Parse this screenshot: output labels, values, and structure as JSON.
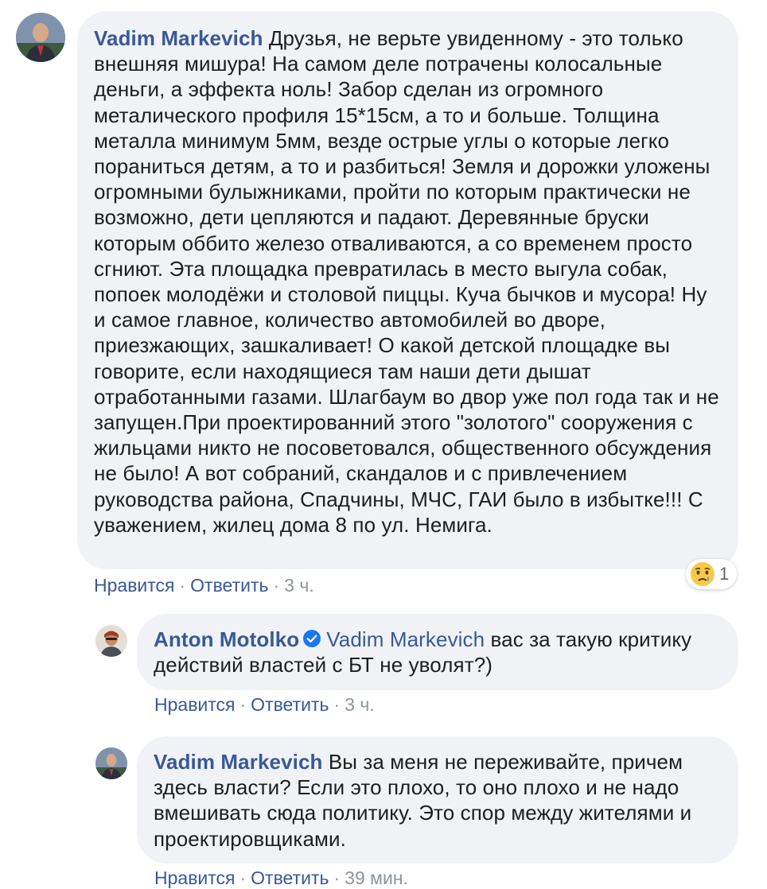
{
  "comments": [
    {
      "author": "Vadim Markevich",
      "text": "Друзья, не верьте увиденному - это только внешняя мишура! На самом деле потрачены колосальные деньги, а эффекта ноль! Забор сделан из огромного металического профиля 15*15см, а то и больше. Толщина металла минимум 5мм, везде острые углы о которые легко пораниться детям, а то и разбиться! Земля и дорожки уложены огромными булыжниками, пройти по которым практически не возможно, дети цепляются и падают. Деревянные бруски которым оббито железо отваливаются, а со временем просто сгниют. Эта площадка превратилась в место выгула собак, попоек молодёжи и столовой пиццы. Куча бычков и мусора! Ну и самое главное, количество автомобилей во дворе, приезжающих, зашкаливает! О какой детской площадке вы говорите, если находящиеся там наши дети дышат отработанными газами. Шлагбаум во двор уже пол года так и не запущен.При проектированний этого \"золотого\" сооружения с жильцами никто не посоветовался, общественного обсуждения не было! А вот собраний, скандалов и с привлечением руководства района, Спадчины, МЧС, ГАИ было в избытке!!! С уважением, жилец дома 8 по ул. Немига.",
      "like": "Нравится",
      "reply": "Ответить",
      "time": "3 ч.",
      "reaction": {
        "icon": "sad-face-icon",
        "count": "1"
      }
    },
    {
      "author": "Anton Motolko",
      "verified": true,
      "mention": "Vadim Markevich",
      "text": "вас за такую критику действий властей с БТ не уволят?)",
      "like": "Нравится",
      "reply": "Ответить",
      "time": "3 ч."
    },
    {
      "author": "Vadim Markevich",
      "text": "Вы за меня не переживайте, причем здесь власти? Если это плохо, то оно плохо и не надо вмешивать сюда политику. Это спор между жителями и проектировщиками.",
      "like": "Нравится",
      "reply": "Ответить",
      "time": "39 мин."
    }
  ],
  "separator": "·",
  "colors": {
    "link": "#385898",
    "bubble": "#f0f2f5",
    "meta": "#8d949e",
    "verified": "#1877f2"
  }
}
